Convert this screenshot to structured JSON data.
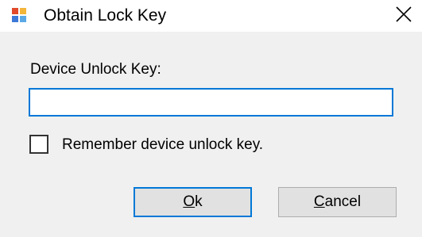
{
  "window": {
    "title": "Obtain Lock Key",
    "icon": "application-window-icon",
    "close_icon": "close-icon"
  },
  "form": {
    "key_label": "Device Unlock Key:",
    "key_value": "",
    "remember_label": "Remember device unlock key.",
    "remember_checked": false
  },
  "buttons": {
    "ok_accel": "O",
    "ok_rest": "k",
    "cancel_accel": "C",
    "cancel_rest": "ancel"
  },
  "colors": {
    "focus_accent": "#0078d7",
    "dialog_background": "#f0f0f0",
    "button_face": "#e1e1e1"
  }
}
